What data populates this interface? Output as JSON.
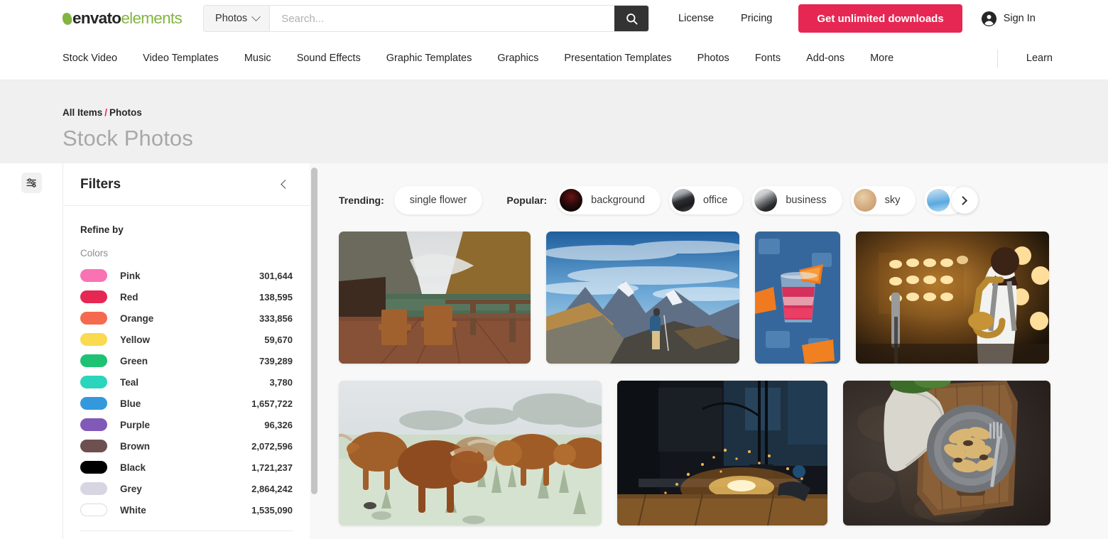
{
  "header": {
    "logo": {
      "brand": "envato",
      "product": "elements"
    },
    "search": {
      "category": "Photos",
      "placeholder": "Search...",
      "value": "",
      "search_icon": "search-icon",
      "chevron_icon": "chevron-down-icon"
    },
    "links": [
      {
        "label": "License"
      },
      {
        "label": "Pricing"
      }
    ],
    "cta": {
      "label": "Get unlimited downloads",
      "color": "#e62753"
    },
    "account": {
      "label": "Sign In",
      "icon": "user-circle-icon"
    }
  },
  "nav": {
    "items": [
      {
        "label": "Stock Video"
      },
      {
        "label": "Video Templates"
      },
      {
        "label": "Music"
      },
      {
        "label": "Sound Effects"
      },
      {
        "label": "Graphic Templates"
      },
      {
        "label": "Graphics"
      },
      {
        "label": "Presentation Templates"
      },
      {
        "label": "Photos"
      },
      {
        "label": "Fonts"
      },
      {
        "label": "Add-ons"
      },
      {
        "label": "More"
      }
    ],
    "right": {
      "label": "Learn"
    }
  },
  "hero": {
    "breadcrumb": {
      "root": "All Items",
      "separator": "/",
      "current": "Photos"
    },
    "title": "Stock Photos"
  },
  "sidebar": {
    "rail_icon": "sliders-filter-icon",
    "title": "Filters",
    "collapse_icon": "chevron-left-icon",
    "refine_by": "Refine by",
    "colors_label": "Colors",
    "colors": [
      {
        "name": "Pink",
        "count": "301,644",
        "hex": "#f972b4"
      },
      {
        "name": "Red",
        "count": "138,595",
        "hex": "#e62753"
      },
      {
        "name": "Orange",
        "count": "333,856",
        "hex": "#f56a4f"
      },
      {
        "name": "Yellow",
        "count": "59,670",
        "hex": "#fada4e"
      },
      {
        "name": "Green",
        "count": "739,289",
        "hex": "#1ec273"
      },
      {
        "name": "Teal",
        "count": "3,780",
        "hex": "#2bd5bb"
      },
      {
        "name": "Blue",
        "count": "1,657,722",
        "hex": "#3498dd"
      },
      {
        "name": "Purple",
        "count": "96,326",
        "hex": "#8159b8"
      },
      {
        "name": "Brown",
        "count": "2,072,596",
        "hex": "#6e5050"
      },
      {
        "name": "Black",
        "count": "1,721,237",
        "hex": "#000000"
      },
      {
        "name": "Grey",
        "count": "2,864,242",
        "hex": "#d8d5e3"
      },
      {
        "name": "White",
        "count": "1,535,090",
        "hex": "#ffffff"
      }
    ]
  },
  "main": {
    "trending": {
      "label": "Trending:",
      "chips": [
        {
          "label": "single flower"
        }
      ]
    },
    "popular": {
      "label": "Popular:",
      "chips": [
        {
          "label": "background"
        },
        {
          "label": "office"
        },
        {
          "label": "business"
        },
        {
          "label": "sky"
        }
      ],
      "next_icon": "chevron-right-icon"
    },
    "grid": {
      "rows": [
        [
          {
            "name": "lake-dock-chairs-autumn-mountains"
          },
          {
            "name": "hiker-backpack-mountain-ridge"
          },
          {
            "name": "cocktail-glass-orange-slices"
          },
          {
            "name": "saxophone-player-stage-lights"
          }
        ],
        [
          {
            "name": "highland-cattle-frosty-field"
          },
          {
            "name": "industrial-welding-sparks"
          },
          {
            "name": "pasta-mushrooms-rustic-board"
          }
        ]
      ]
    }
  }
}
